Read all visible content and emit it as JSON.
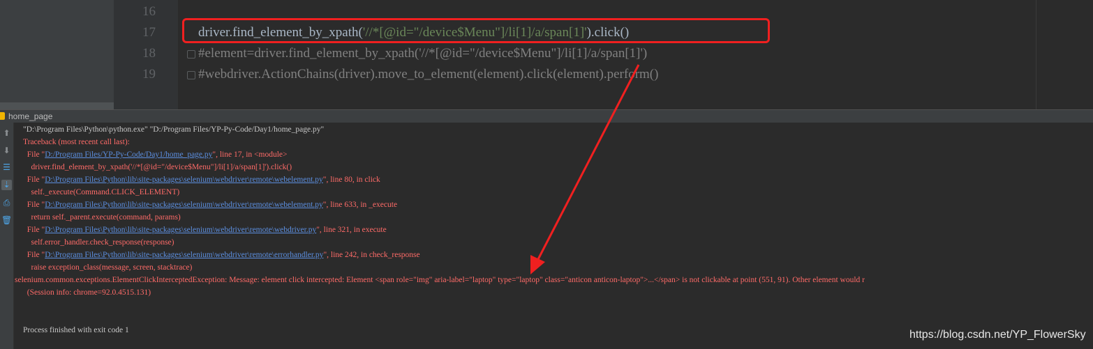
{
  "editor": {
    "lines": [
      {
        "num": "16",
        "code": ""
      },
      {
        "num": "17",
        "pre": "driver.find_element_by_xpath(",
        "str": "'//*[@id=\"/device$Menu\"]/li[1]/a/span[1]'",
        "post": ").click()"
      },
      {
        "num": "18",
        "code": "#element=driver.find_element_by_xpath('//*[@id=\"/device$Menu\"]/li[1]/a/span[1]')"
      },
      {
        "num": "19",
        "code": "#webdriver.ActionChains(driver).move_to_element(element).click(element).perform()"
      }
    ]
  },
  "run_panel": {
    "title": "home_page",
    "toolbar_icons": [
      "up-arrow-icon",
      "down-arrow-icon",
      "wrap-icon",
      "scroll-to-end-icon",
      "print-icon",
      "trash-icon"
    ]
  },
  "console": {
    "lines": [
      {
        "type": "cmd",
        "text": "\"D:\\Program Files\\Python\\python.exe\" \"D:/Program Files/YP-Py-Code/Day1/home_page.py\""
      },
      {
        "type": "err",
        "text": "Traceback (most recent call last):"
      },
      {
        "type": "err-file",
        "pre": "  File \"",
        "link": "D:/Program Files/YP-Py-Code/Day1/home_page.py",
        "post": "\", line 17, in <module>"
      },
      {
        "type": "err",
        "text": "    driver.find_element_by_xpath('//*[@id=\"/device$Menu\"]/li[1]/a/span[1]').click()"
      },
      {
        "type": "err-file",
        "pre": "  File \"",
        "link": "D:\\Program Files\\Python\\lib\\site-packages\\selenium\\webdriver\\remote\\webelement.py",
        "post": "\", line 80, in click"
      },
      {
        "type": "err",
        "text": "    self._execute(Command.CLICK_ELEMENT)"
      },
      {
        "type": "err-file",
        "pre": "  File \"",
        "link": "D:\\Program Files\\Python\\lib\\site-packages\\selenium\\webdriver\\remote\\webelement.py",
        "post": "\", line 633, in _execute"
      },
      {
        "type": "err",
        "text": "    return self._parent.execute(command, params)"
      },
      {
        "type": "err-file",
        "pre": "  File \"",
        "link": "D:\\Program Files\\Python\\lib\\site-packages\\selenium\\webdriver\\remote\\webdriver.py",
        "post": "\", line 321, in execute"
      },
      {
        "type": "err",
        "text": "    self.error_handler.check_response(response)"
      },
      {
        "type": "err-file",
        "pre": "  File \"",
        "link": "D:\\Program Files\\Python\\lib\\site-packages\\selenium\\webdriver\\remote\\errorhandler.py",
        "post": "\", line 242, in check_response"
      },
      {
        "type": "err",
        "text": "    raise exception_class(message, screen, stacktrace)"
      },
      {
        "type": "err",
        "text": "selenium.common.exceptions.ElementClickInterceptedException: Message: element click intercepted: Element <span role=\"img\" aria-label=\"laptop\" type=\"laptop\" class=\"anticon anticon-laptop\">...</span> is not clickable at point (551, 91). Other element would r"
      },
      {
        "type": "err",
        "text": "  (Session info: chrome=92.0.4515.131)"
      },
      {
        "type": "blank",
        "text": ""
      },
      {
        "type": "blank",
        "text": ""
      },
      {
        "type": "normal",
        "text": "Process finished with exit code 1"
      }
    ]
  },
  "watermark": "https://blog.csdn.net/YP_FlowerSky",
  "colors": {
    "editor_bg": "#2b2b2b",
    "string": "#6a8759",
    "comment": "#808080",
    "error": "#ff6b68",
    "link": "#5c8fe0",
    "annotation": "#f02020"
  }
}
